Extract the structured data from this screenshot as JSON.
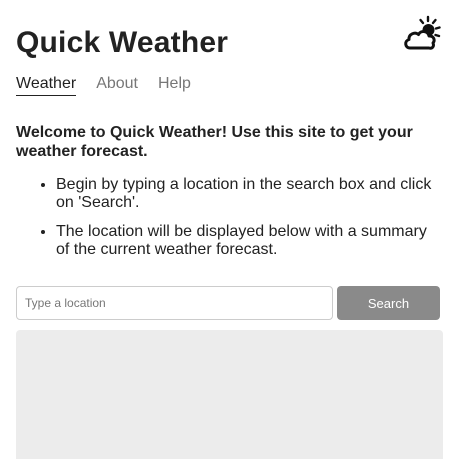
{
  "header": {
    "title": "Quick Weather",
    "logo_icon": "sun-cloud-icon"
  },
  "nav": {
    "items": [
      {
        "label": "Weather",
        "active": true
      },
      {
        "label": "About",
        "active": false
      },
      {
        "label": "Help",
        "active": false
      }
    ]
  },
  "intro": {
    "text": "Welcome to Quick Weather! Use this site to get your weather forecast."
  },
  "steps": [
    "Begin by typing a location in the search box and click on 'Search'.",
    "The location will be displayed below with a summary of the current weather forecast."
  ],
  "search": {
    "placeholder": "Type a location",
    "button_label": "Search"
  },
  "colors": {
    "button_bg": "#8a8a8a",
    "results_bg": "#ececec",
    "nav_inactive": "#777777",
    "text": "#222222"
  }
}
